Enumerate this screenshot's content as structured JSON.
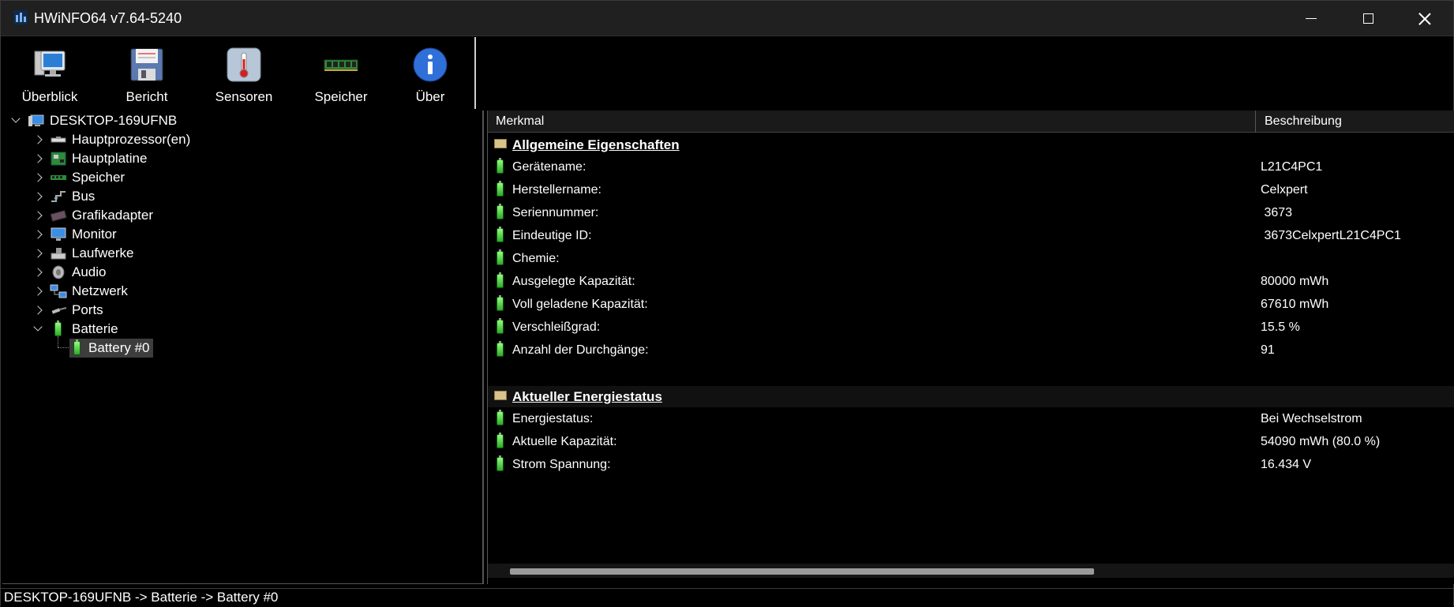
{
  "window": {
    "title": "HWiNFO64 v7.64-5240"
  },
  "toolbar": [
    {
      "label": "Überblick",
      "icon": "computer-monitor-icon"
    },
    {
      "label": "Bericht",
      "icon": "floppy-disk-icon"
    },
    {
      "label": "Sensoren",
      "icon": "thermometer-icon"
    },
    {
      "label": "Speicher",
      "icon": "memory-module-icon"
    },
    {
      "label": "Über",
      "icon": "info-icon"
    }
  ],
  "tree": {
    "root": {
      "label": "DESKTOP-169UFNB"
    },
    "items": [
      {
        "label": "Hauptprozessor(en)"
      },
      {
        "label": "Hauptplatine"
      },
      {
        "label": "Speicher"
      },
      {
        "label": "Bus"
      },
      {
        "label": "Grafikadapter"
      },
      {
        "label": "Monitor"
      },
      {
        "label": "Laufwerke"
      },
      {
        "label": "Audio"
      },
      {
        "label": "Netzwerk"
      },
      {
        "label": "Ports"
      },
      {
        "label": "Batterie"
      }
    ],
    "selected_child": {
      "label": "Battery #0"
    }
  },
  "details": {
    "columns": {
      "feature": "Merkmal",
      "description": "Beschreibung"
    },
    "section1": {
      "title": "Allgemeine Eigenschaften",
      "rows": [
        {
          "label": "Gerätename:",
          "value": "L21C4PC1"
        },
        {
          "label": "Herstellername:",
          "value": "Celxpert"
        },
        {
          "label": "Seriennummer:",
          "value": " 3673"
        },
        {
          "label": "Eindeutige ID:",
          "value": " 3673CelxpertL21C4PC1"
        },
        {
          "label": "Chemie:",
          "value": ""
        },
        {
          "label": "Ausgelegte Kapazität:",
          "value": "80000 mWh"
        },
        {
          "label": "Voll geladene Kapazität:",
          "value": "67610 mWh"
        },
        {
          "label": "Verschleißgrad:",
          "value": "15.5 %"
        },
        {
          "label": "Anzahl der Durchgänge:",
          "value": "91"
        }
      ]
    },
    "section2": {
      "title": "Aktueller Energiestatus",
      "rows": [
        {
          "label": "Energiestatus:",
          "value": "Bei Wechselstrom"
        },
        {
          "label": "Aktuelle Kapazität:",
          "value": "54090 mWh (80.0 %)"
        },
        {
          "label": "Strom Spannung:",
          "value": "16.434 V"
        }
      ]
    }
  },
  "statusbar": {
    "path": "DESKTOP-169UFNB -> Batterie -> Battery #0"
  }
}
